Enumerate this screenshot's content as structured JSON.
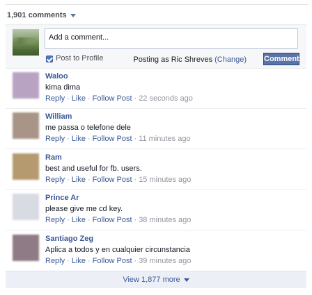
{
  "header": {
    "comment_count": "1,901 comments"
  },
  "compose": {
    "placeholder": "Add a comment...",
    "post_to_profile": "Post to Profile",
    "posting_as_prefix": "Posting as Ric Shreves",
    "change_link": "(Change)",
    "comment_button": "Comment"
  },
  "actions": {
    "reply": "Reply",
    "like": "Like",
    "follow": "Follow Post",
    "sep": "·"
  },
  "comments": [
    {
      "name": "Waloo",
      "text": "kima dima",
      "time": "22 seconds ago",
      "avatar_color": "#b8a3c2"
    },
    {
      "name": "William",
      "text": "me passa o telefone dele",
      "time": "11 minutes ago",
      "avatar_color": "#a89587"
    },
    {
      "name": "Ram",
      "text": "best and useful for fb. users.",
      "time": "15 minutes ago",
      "avatar_color": "#b49a6e"
    },
    {
      "name": "Prince Ar",
      "text": "please give me cd key.",
      "time": "38 minutes ago",
      "avatar_color": "#d8dbe2"
    },
    {
      "name": "Santiago Zeg",
      "text": "Aplica a todos y en cualquier circunstancia",
      "time": "39 minutes ago",
      "avatar_color": "#8e7b86"
    }
  ],
  "view_more": {
    "label": "View 1,877 more"
  },
  "colors": {
    "link": "#3b5998",
    "button": "#5b74a8",
    "muted": "#90949c"
  }
}
